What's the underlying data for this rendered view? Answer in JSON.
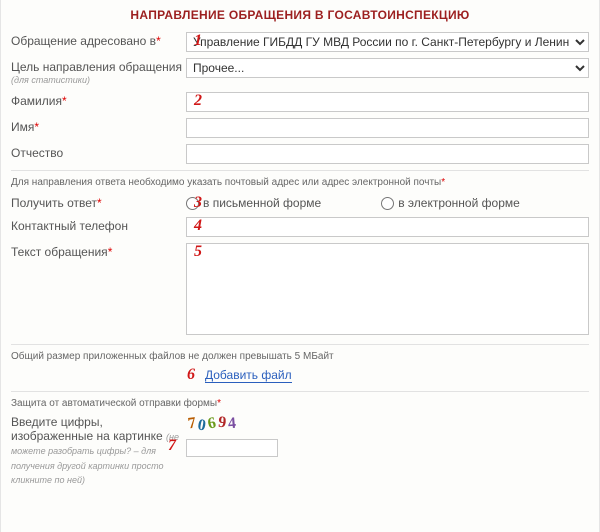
{
  "title": "НАПРАВЛЕНИЕ ОБРАЩЕНИЯ В ГОСАВТОИНСПЕКЦИЮ",
  "markers": {
    "m1": "1",
    "m2": "2",
    "m3": "3",
    "m4": "4",
    "m5": "5",
    "m6": "6",
    "m7": "7"
  },
  "addressed_to": {
    "label": "Обращение адресовано в",
    "value": "Управление ГИБДД ГУ МВД России по г. Санкт-Петербургу и Ленинградской области"
  },
  "purpose": {
    "label": "Цель направления обращения",
    "sublabel": "(для статистики)",
    "value": "Прочее..."
  },
  "surname": {
    "label": "Фамилия",
    "value": ""
  },
  "name": {
    "label": "Имя",
    "value": ""
  },
  "patronymic": {
    "label": "Отчество",
    "value": ""
  },
  "reply_note": "Для направления ответа необходимо указать почтовый адрес или адрес электронной почты",
  "get_reply": {
    "label": "Получить ответ",
    "option_written": "в письменной форме",
    "option_electronic": "в электронной форме"
  },
  "phone": {
    "label": "Контактный телефон",
    "value": ""
  },
  "text": {
    "label": "Текст обращения",
    "value": ""
  },
  "files_note": "Общий размер приложенных файлов не должен превышать 5 МБайт",
  "attach_link": "Добавить файл",
  "captcha": {
    "section_label": "Защита от автоматической отправки формы",
    "label": "Введите цифры, изображенные на картинке",
    "hint": "(не можете разобрать цифры? – для получения другой картинки просто кликните по ней)",
    "digits": [
      "7",
      "0",
      "6",
      "9",
      "4"
    ],
    "value": ""
  }
}
